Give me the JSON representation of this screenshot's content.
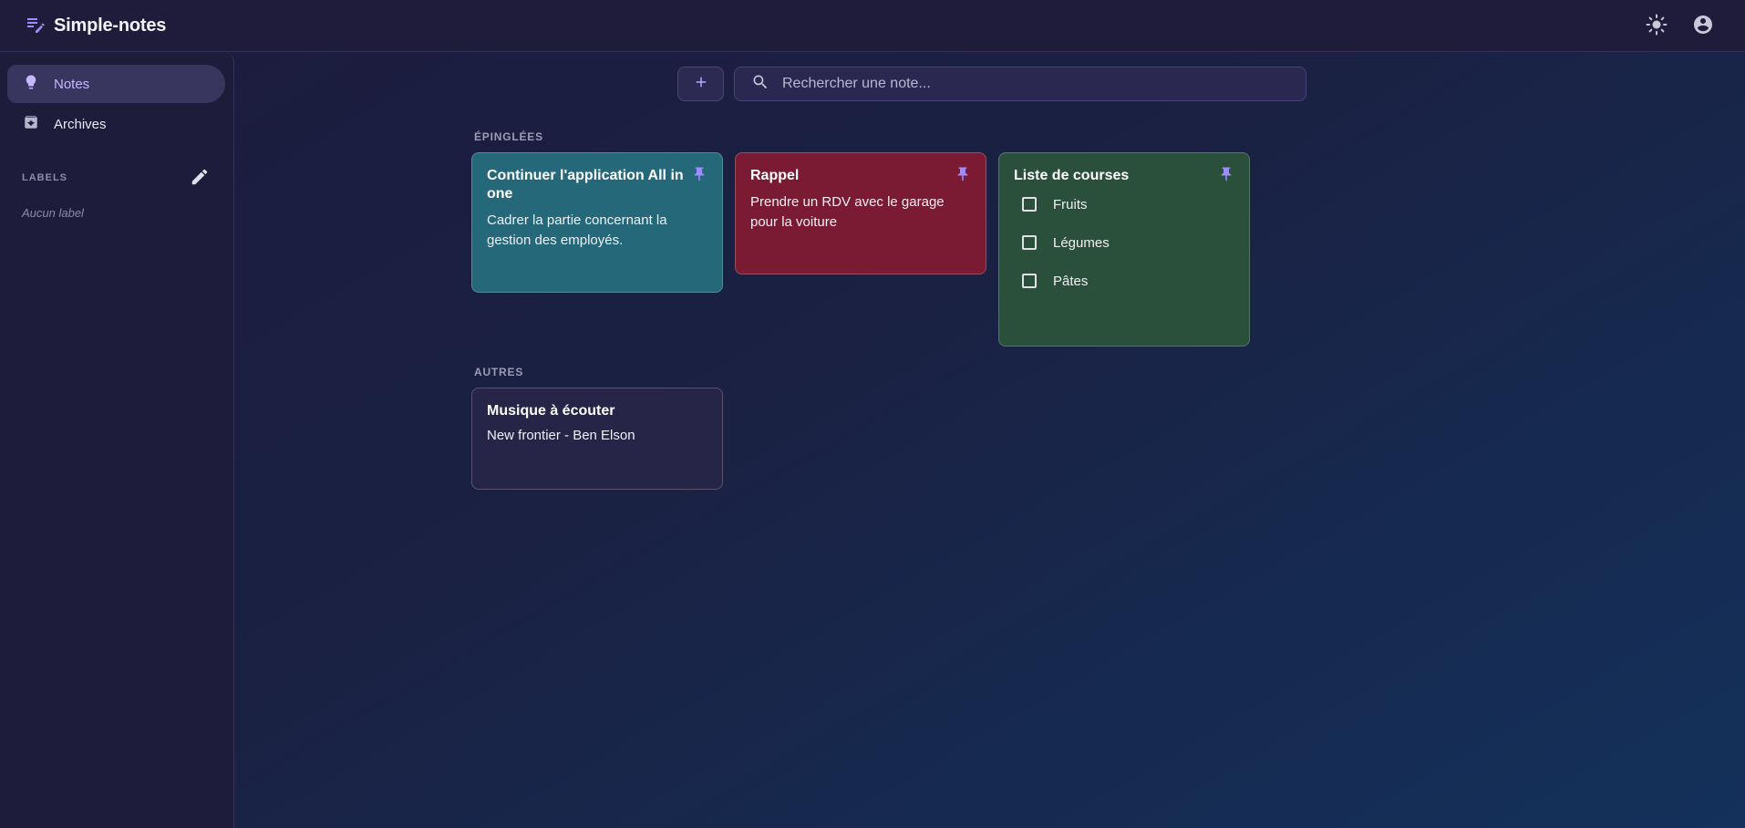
{
  "app": {
    "title": "Simple-notes"
  },
  "colors": {
    "accent": "#9f8cff",
    "note_teal": "#25687a",
    "note_red": "#7a1b33",
    "note_green": "#2a503b",
    "note_purple": "#262447"
  },
  "topbar": {
    "theme_icon": "sun-icon",
    "account_icon": "account-circle-icon"
  },
  "sidebar": {
    "items": [
      {
        "label": "Notes",
        "icon": "lightbulb-icon",
        "active": true
      },
      {
        "label": "Archives",
        "icon": "archive-icon",
        "active": false
      }
    ],
    "labels_heading": "LABELS",
    "no_labels": "Aucun label"
  },
  "search": {
    "placeholder": "Rechercher une note..."
  },
  "sections": {
    "pinned": "ÉPINGLÉES",
    "others": "AUTRES"
  },
  "pinned_notes": [
    {
      "title": "Continuer l'application All in one",
      "body": "Cadrer la partie concernant la gestion des employés.",
      "color": "#25687a",
      "pinned": true
    },
    {
      "title": "Rappel",
      "body": "Prendre un RDV avec le garage pour la voiture",
      "color": "#7a1b33",
      "pinned": true
    },
    {
      "title": "Liste de courses",
      "items": [
        "Fruits",
        "Légumes",
        "Pâtes"
      ],
      "color": "#2a503b",
      "pinned": true
    }
  ],
  "other_notes": [
    {
      "title": "Musique à écouter",
      "body": "New frontier - Ben Elson",
      "color": "#262447",
      "pinned": false
    }
  ]
}
